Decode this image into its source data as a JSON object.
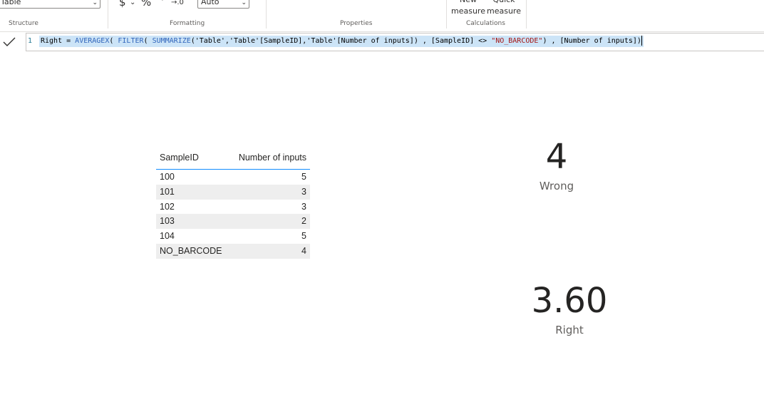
{
  "ribbon": {
    "type_select_value": "Table",
    "format_select_value": "Auto",
    "currency_symbol": "$",
    "percent_symbol": "%",
    "comma_symbol": "ʼ",
    "decimal_symbol": "→.0",
    "groups": {
      "structure": "Structure",
      "formatting": "Formatting",
      "properties": "Properties",
      "calculations": "Calculations"
    },
    "new_measure": [
      "New",
      "measure"
    ],
    "quick_measure": [
      "Quick",
      "measure"
    ]
  },
  "formula": {
    "line_number": "1",
    "tokens": [
      {
        "t": "Right = ",
        "k": "name"
      },
      {
        "t": "AVERAGEX",
        "k": "fn"
      },
      {
        "t": "( ",
        "k": "name"
      },
      {
        "t": "FILTER",
        "k": "fn"
      },
      {
        "t": "( ",
        "k": "name"
      },
      {
        "t": "SUMMARIZE",
        "k": "fn"
      },
      {
        "t": "('Table','Table'[SampleID],'Table'[Number of inputs]) , [SampleID] <> ",
        "k": "name"
      },
      {
        "t": "\"NO_BARCODE\"",
        "k": "str"
      },
      {
        "t": ") , [Number of inputs])",
        "k": "name"
      }
    ]
  },
  "table": {
    "headers": [
      "SampleID",
      "Number of inputs"
    ],
    "rows": [
      [
        "100",
        "5"
      ],
      [
        "101",
        "3"
      ],
      [
        "102",
        "3"
      ],
      [
        "103",
        "2"
      ],
      [
        "104",
        "5"
      ],
      [
        "NO_BARCODE",
        "4"
      ]
    ]
  },
  "cards": {
    "wrong": {
      "value": "4",
      "label": "Wrong"
    },
    "right": {
      "value": "3.60",
      "label": "Right"
    }
  },
  "colors": {
    "accent": "#118dff",
    "selection": "#cce4f7",
    "function": "#3165bb",
    "string": "#a31515"
  },
  "icons": [
    "checkmark-icon",
    "chevron-down-icon",
    "dollar-icon",
    "percent-icon",
    "comma-style-icon",
    "decimal-icon"
  ]
}
